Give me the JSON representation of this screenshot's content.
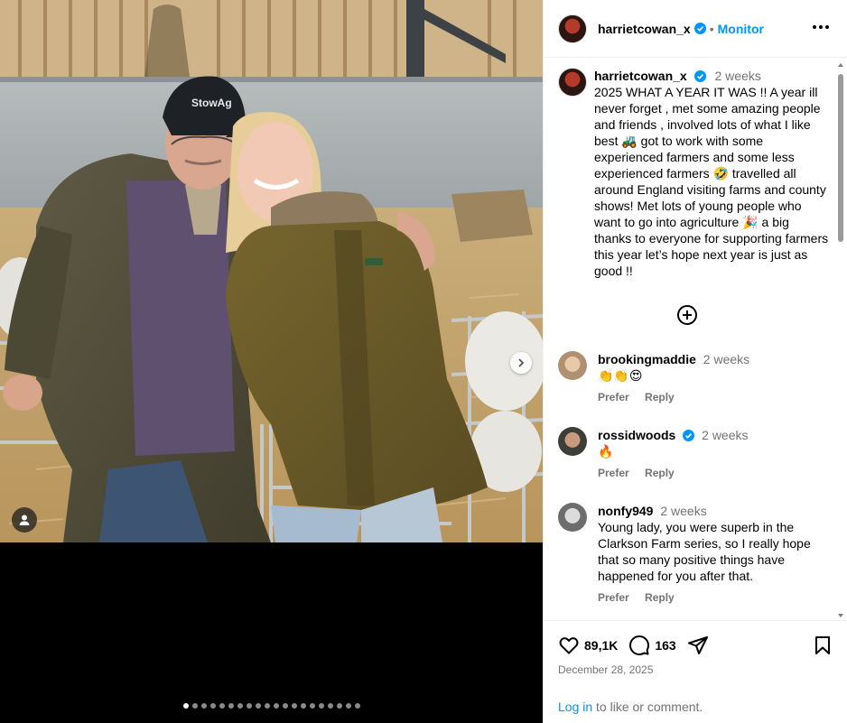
{
  "post": {
    "author": "harrietcowan_x",
    "follow_label": "Monitor",
    "separator": "•"
  },
  "media": {
    "photo_alt": "Older man in cap and young blonde woman in olive jacket smiling in a barn with sheep",
    "cap_logo_text": "StowAg",
    "slide_count": 20,
    "active_slide": 1
  },
  "caption": {
    "author": "harrietcowan_x",
    "time": "2 weeks",
    "text": "2025 WHAT A YEAR IT WAS !! A year ill never forget , met some amazing people and friends , involved lots of what I like best 🚜 got to work with some experienced farmers and some less experienced farmers 🤣 travelled all around England visiting farms and county shows! Met lots of young people who want to go into agriculture 🎉 a big thanks to everyone for supporting farmers this year let’s hope next year is just as good !!"
  },
  "comments": [
    {
      "user": "brookingmaddie",
      "time": "2 weeks",
      "text": "👏👏😍",
      "like_label": "Prefer",
      "reply_label": "Reply"
    },
    {
      "user": "rossidwoods",
      "time": "2 weeks",
      "text": "🔥",
      "like_label": "Prefer",
      "reply_label": "Reply"
    },
    {
      "user": "nonfy949",
      "time": "2 weeks",
      "text": "Young lady, you were superb in the Clarkson Farm series, so I really hope that so many positive things have happened for you after that.",
      "like_label": "Prefer",
      "reply_label": "Reply"
    }
  ],
  "stats": {
    "likes": "89,1K",
    "comments": "163"
  },
  "date": "December 28, 2025",
  "login": {
    "link": "Log in",
    "rest": " to like or comment."
  },
  "colors": {
    "accent": "#0095f6",
    "muted": "#737373",
    "verified": "#0095f6"
  },
  "icons": [
    "more-icon",
    "verified-icon",
    "load-more-icon",
    "heart-icon",
    "comment-icon",
    "share-icon",
    "bookmark-icon",
    "user-tag-icon",
    "chevron-right-icon"
  ]
}
